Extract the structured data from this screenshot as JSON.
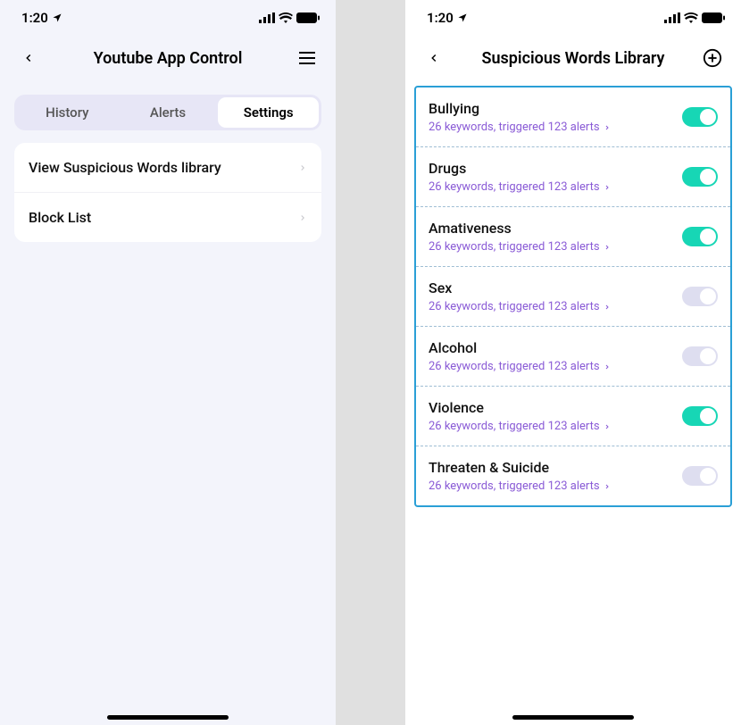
{
  "status_time": "1:20",
  "left": {
    "title": "Youtube App Control",
    "tabs": [
      {
        "label": "History",
        "active": false
      },
      {
        "label": "Alerts",
        "active": false
      },
      {
        "label": "Settings",
        "active": true
      }
    ],
    "rows": [
      {
        "label": "View Suspicious Words library"
      },
      {
        "label": "Block List"
      }
    ]
  },
  "right": {
    "title": "Suspicious  Words Library",
    "categories": [
      {
        "title": "Bullying",
        "subtitle": "26 keywords, triggered 123 alerts",
        "enabled": true
      },
      {
        "title": "Drugs",
        "subtitle": "26 keywords, triggered 123 alerts",
        "enabled": true
      },
      {
        "title": "Amativeness",
        "subtitle": "26 keywords, triggered 123 alerts",
        "enabled": true
      },
      {
        "title": "Sex",
        "subtitle": "26 keywords, triggered 123 alerts",
        "enabled": false
      },
      {
        "title": "Alcohol",
        "subtitle": "26 keywords, triggered 123 alerts",
        "enabled": false
      },
      {
        "title": "Violence",
        "subtitle": "26 keywords, triggered 123 alerts",
        "enabled": true
      },
      {
        "title": "Threaten & Suicide",
        "subtitle": "26 keywords, triggered 123 alerts",
        "enabled": false
      }
    ]
  }
}
